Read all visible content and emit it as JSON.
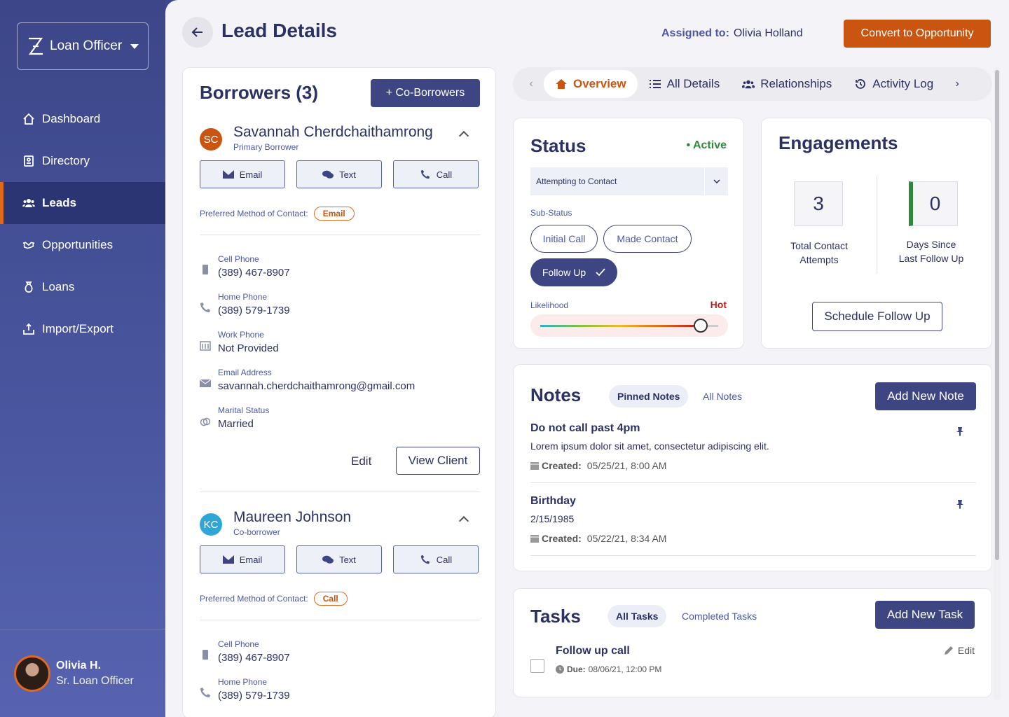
{
  "sidebar": {
    "app_name": "Loan Officer",
    "nav": [
      {
        "label": "Dashboard",
        "icon": "home-icon"
      },
      {
        "label": "Directory",
        "icon": "directory-icon"
      },
      {
        "label": "Leads",
        "icon": "users-icon",
        "active": true
      },
      {
        "label": "Opportunities",
        "icon": "handshake-icon"
      },
      {
        "label": "Loans",
        "icon": "loan-bag-icon"
      },
      {
        "label": "Import/Export",
        "icon": "import-export-icon"
      }
    ],
    "profile": {
      "name": "Olivia H.",
      "role": "Sr. Loan Officer"
    }
  },
  "header": {
    "title": "Lead Details",
    "assigned_label": "Assigned to:",
    "assigned_name": "Olivia Holland",
    "convert_label": "Convert to Opportunity"
  },
  "borrowers": {
    "title": "Borrowers (3)",
    "add_label": "+ Co-Borrowers",
    "actions": {
      "email": "Email",
      "text": "Text",
      "call": "Call"
    },
    "pref_label": "Preferred Method of Contact:",
    "list": [
      {
        "initials": "SC",
        "color": "#c95510",
        "name": "Savannah Cherdchaithamrong",
        "role": "Primary Borrower",
        "preferred": "Email",
        "details": [
          {
            "label": "Cell Phone",
            "value": "(389) 467-8907",
            "icon": "mobile-phone-icon"
          },
          {
            "label": "Home Phone",
            "value": "(389) 579-1739",
            "icon": "phone-icon"
          },
          {
            "label": "Work Phone",
            "value": "Not Provided",
            "icon": "building-icon"
          },
          {
            "label": "Email Address",
            "value": "savannah.cherdchaithamrong@gmail.com",
            "icon": "envelope-icon"
          },
          {
            "label": "Marital Status",
            "value": "Married",
            "icon": "rings-icon"
          }
        ]
      },
      {
        "initials": "KC",
        "color": "#2fa6d6",
        "name": "Maureen Johnson",
        "role": "Co-borrower",
        "preferred": "Call",
        "details": [
          {
            "label": "Cell Phone",
            "value": "(389) 467-8907",
            "icon": "mobile-phone-icon"
          },
          {
            "label": "Home Phone",
            "value": "(389) 579-1739",
            "icon": "phone-icon"
          }
        ]
      }
    ],
    "edit_label": "Edit",
    "view_client_label": "View Client"
  },
  "tabs": [
    {
      "label": "Overview",
      "active": true
    },
    {
      "label": "All Details"
    },
    {
      "label": "Relationships"
    },
    {
      "label": "Activity Log"
    }
  ],
  "status": {
    "title": "Status",
    "state": "Active",
    "selected": "Attempting to Contact",
    "sub_label": "Sub-Status",
    "chips": [
      "Initial Call",
      "Made Contact",
      "Follow Up"
    ],
    "selected_chip": "Follow Up",
    "likelihood_label": "Likelihood",
    "likelihood_value": "Hot",
    "likelihood_level": 0.9
  },
  "engagements": {
    "title": "Engagements",
    "total_attempts": "3",
    "total_label_1": "Total Contact",
    "total_label_2": "Attempts",
    "days_since": "0",
    "days_label_1": "Days Since",
    "days_label_2": "Last Follow Up",
    "schedule_label": "Schedule Follow Up"
  },
  "notes": {
    "title": "Notes",
    "tab_pinned": "Pinned Notes",
    "tab_all": "All Notes",
    "add_label": "Add New Note",
    "created_label": "Created:",
    "items": [
      {
        "title": "Do not call past 4pm",
        "body": "Lorem ipsum dolor sit amet, consectetur adipiscing elit.",
        "created": "05/25/21, 8:00 AM"
      },
      {
        "title": "Birthday",
        "body": "2/15/1985",
        "created": "05/22/21, 8:34 AM"
      }
    ]
  },
  "tasks": {
    "title": "Tasks",
    "tab_all": "All Tasks",
    "tab_completed": "Completed Tasks",
    "add_label": "Add New Task",
    "due_label": "Due:",
    "edit_label": "Edit",
    "items": [
      {
        "name": "Follow up call",
        "due": "08/06/21, 12:00 PM"
      }
    ]
  },
  "colors": {
    "sidebar": "#3c4688",
    "accent": "#c95510",
    "primary": "#3d4682",
    "active_green": "#2e8a3a",
    "hot_red": "#c01818"
  }
}
